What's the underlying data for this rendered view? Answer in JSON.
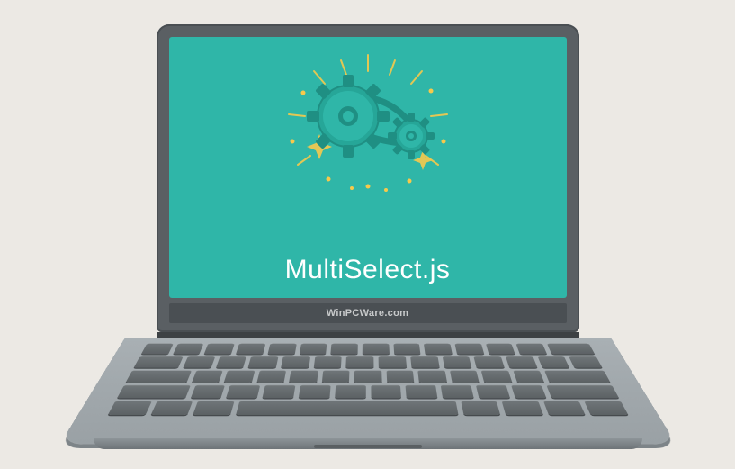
{
  "screen": {
    "filename": "MultiSelect.js",
    "bg_color": "#2fb6a8",
    "text_color": "#ffffff"
  },
  "brand": "WinPCWare.com",
  "icons": {
    "main": "gears-icon"
  }
}
